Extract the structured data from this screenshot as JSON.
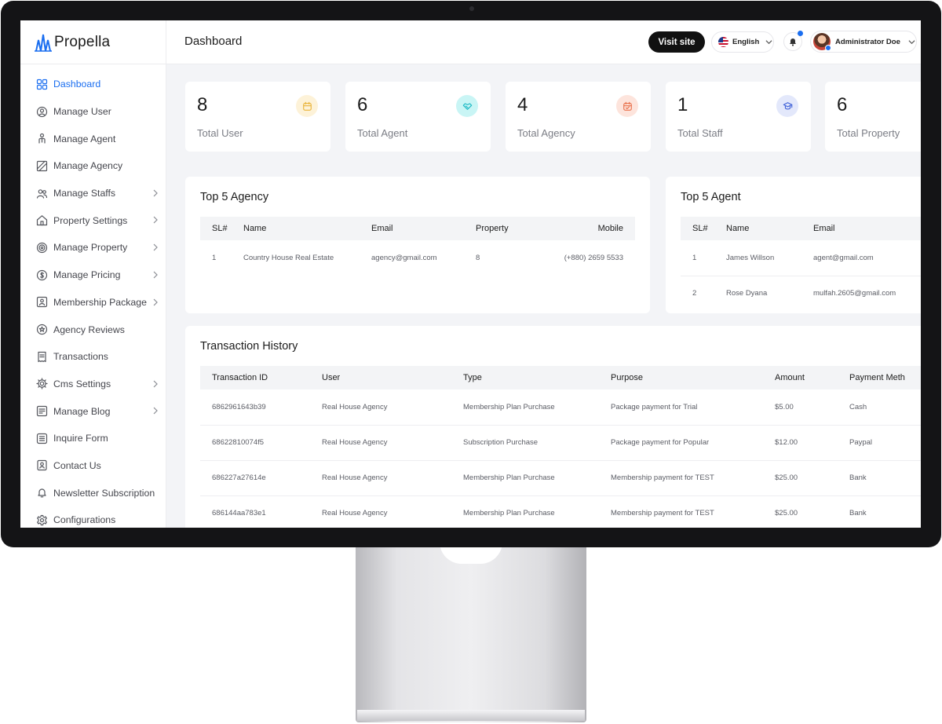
{
  "app": {
    "name": "Propella"
  },
  "sidebar": {
    "items": [
      {
        "label": "Dashboard",
        "icon": "grid-icon",
        "active": true,
        "has_children": false
      },
      {
        "label": "Manage User",
        "icon": "user-circle-icon",
        "active": false,
        "has_children": false
      },
      {
        "label": "Manage Agent",
        "icon": "agent-icon",
        "active": false,
        "has_children": false
      },
      {
        "label": "Manage Agency",
        "icon": "building-icon",
        "active": false,
        "has_children": false
      },
      {
        "label": "Manage Staffs",
        "icon": "users-icon",
        "active": false,
        "has_children": true
      },
      {
        "label": "Property Settings",
        "icon": "home-icon",
        "active": false,
        "has_children": true
      },
      {
        "label": "Manage Property",
        "icon": "target-icon",
        "active": false,
        "has_children": true
      },
      {
        "label": "Manage Pricing",
        "icon": "dollar-icon",
        "active": false,
        "has_children": true
      },
      {
        "label": "Membership Package",
        "icon": "id-card-icon",
        "active": false,
        "has_children": true
      },
      {
        "label": "Agency Reviews",
        "icon": "star-badge-icon",
        "active": false,
        "has_children": false
      },
      {
        "label": "Transactions",
        "icon": "receipt-icon",
        "active": false,
        "has_children": false
      },
      {
        "label": "Cms Settings",
        "icon": "gear-icon",
        "active": false,
        "has_children": true
      },
      {
        "label": "Manage Blog",
        "icon": "blog-icon",
        "active": false,
        "has_children": true
      },
      {
        "label": "Inquire Form",
        "icon": "list-icon",
        "active": false,
        "has_children": false
      },
      {
        "label": "Contact Us",
        "icon": "contact-icon",
        "active": false,
        "has_children": false
      },
      {
        "label": "Newsletter Subscription",
        "icon": "bell-icon",
        "active": false,
        "has_children": false
      },
      {
        "label": "Configurations",
        "icon": "cog-icon",
        "active": false,
        "has_children": false
      }
    ]
  },
  "header": {
    "title": "Dashboard",
    "visit_site": "Visit site",
    "language": "English",
    "user_name": "Administrator Doe",
    "notification_icon": "bell-icon"
  },
  "stats": [
    {
      "value": "8",
      "label": "Total User",
      "icon": "calendar-icon",
      "bg": "#fdf2d8",
      "fg": "#e9b43a"
    },
    {
      "value": "6",
      "label": "Total Agent",
      "icon": "handshake-icon",
      "bg": "#c9f5f5",
      "fg": "#1bb9c4"
    },
    {
      "value": "4",
      "label": "Total Agency",
      "icon": "calendar-check-icon",
      "bg": "#fde4dc",
      "fg": "#e9714c"
    },
    {
      "value": "1",
      "label": "Total Staff",
      "icon": "badge-icon",
      "bg": "#e3e8fb",
      "fg": "#4162d8"
    },
    {
      "value": "6",
      "label": "Total Property",
      "icon": "house-icon",
      "bg": "#fff",
      "fg": "#fff"
    }
  ],
  "top_agency": {
    "title": "Top 5 Agency",
    "columns": [
      "SL#",
      "Name",
      "Email",
      "Property",
      "Mobile"
    ],
    "rows": [
      [
        "1",
        "Country House Real Estate",
        "agency@gmail.com",
        "8",
        "(+880) 2659 5533"
      ]
    ]
  },
  "top_agent": {
    "title": "Top 5 Agent",
    "columns": [
      "SL#",
      "Name",
      "Email"
    ],
    "rows": [
      [
        "1",
        "James Willson",
        "agent@gmail.com"
      ],
      [
        "2",
        "Rose Dyana",
        "mulfah.2605@gmail.com"
      ]
    ]
  },
  "transactions": {
    "title": "Transaction History",
    "columns": [
      "Transaction ID",
      "User",
      "Type",
      "Purpose",
      "Amount",
      "Payment Meth"
    ],
    "rows": [
      [
        "6862961643b39",
        "Real House Agency",
        "Membership Plan Purchase",
        "Package payment for Trial",
        "$5.00",
        "Cash"
      ],
      [
        "68622810074f5",
        "Real House Agency",
        "Subscription Purchase",
        "Package payment for Popular",
        "$12.00",
        "Paypal"
      ],
      [
        "686227a27614e",
        "Real House Agency",
        "Membership Plan Purchase",
        "Membership payment for TEST",
        "$25.00",
        "Bank"
      ],
      [
        "686144aa783e1",
        "Real House Agency",
        "Membership Plan Purchase",
        "Membership payment for TEST",
        "$25.00",
        "Bank"
      ]
    ]
  },
  "colors": {
    "accent": "#1a6ef0",
    "dark": "#111111",
    "muted": "#7b7d85"
  }
}
